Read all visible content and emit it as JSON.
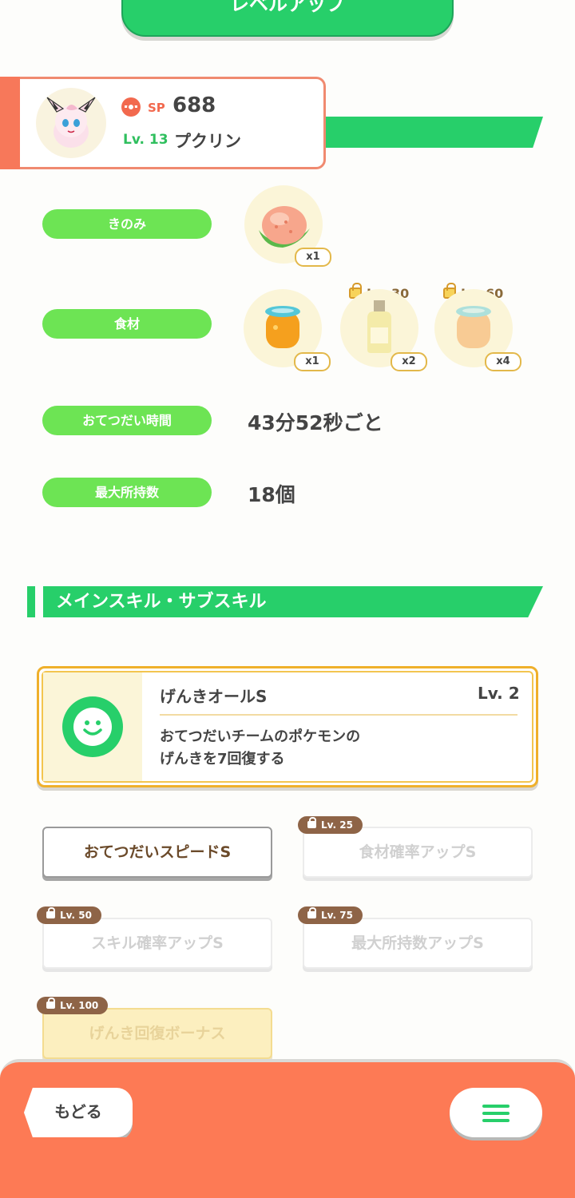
{
  "header": {
    "levelup_label": "レベルアップ"
  },
  "pokemon": {
    "sp_label": "SP",
    "sp_value": "688",
    "level_label": "Lv. 13",
    "name": "プクリン"
  },
  "stats": {
    "berry_label": "きのみ",
    "berry_qty": "x1",
    "ingredient_label": "食材",
    "ingredients": [
      {
        "qty": "x1",
        "lock": ""
      },
      {
        "qty": "x2",
        "lock": "Lv. 30"
      },
      {
        "qty": "x4",
        "lock": "Lv. 60"
      }
    ],
    "help_time_label": "おてつだい時間",
    "help_time_value": "43分52秒ごと",
    "max_carry_label": "最大所持数",
    "max_carry_value": "18個"
  },
  "skills_section": {
    "title": "メインスキル・サブスキル",
    "main_skill": {
      "name": "げんきオールS",
      "level": "Lv. 2",
      "desc_line1": "おてつだいチームのポケモンの",
      "desc_line2": "げんきを7回復する"
    },
    "sub_skills": [
      {
        "name": "おてつだいスピードS",
        "lock": ""
      },
      {
        "name": "食材確率アップS",
        "lock": "Lv. 25"
      },
      {
        "name": "スキル確率アップS",
        "lock": "Lv. 50"
      },
      {
        "name": "最大所持数アップS",
        "lock": "Lv. 75"
      },
      {
        "name": "げんき回復ボーナス",
        "lock": "Lv. 100"
      }
    ]
  },
  "footer": {
    "back_label": "もどる",
    "menu_icon": "hamburger-menu-icon"
  },
  "colors": {
    "accent_green": "#27cf6a",
    "pill_green": "#6de454",
    "footer_orange": "#fd7a55",
    "gold": "#efb02b"
  }
}
